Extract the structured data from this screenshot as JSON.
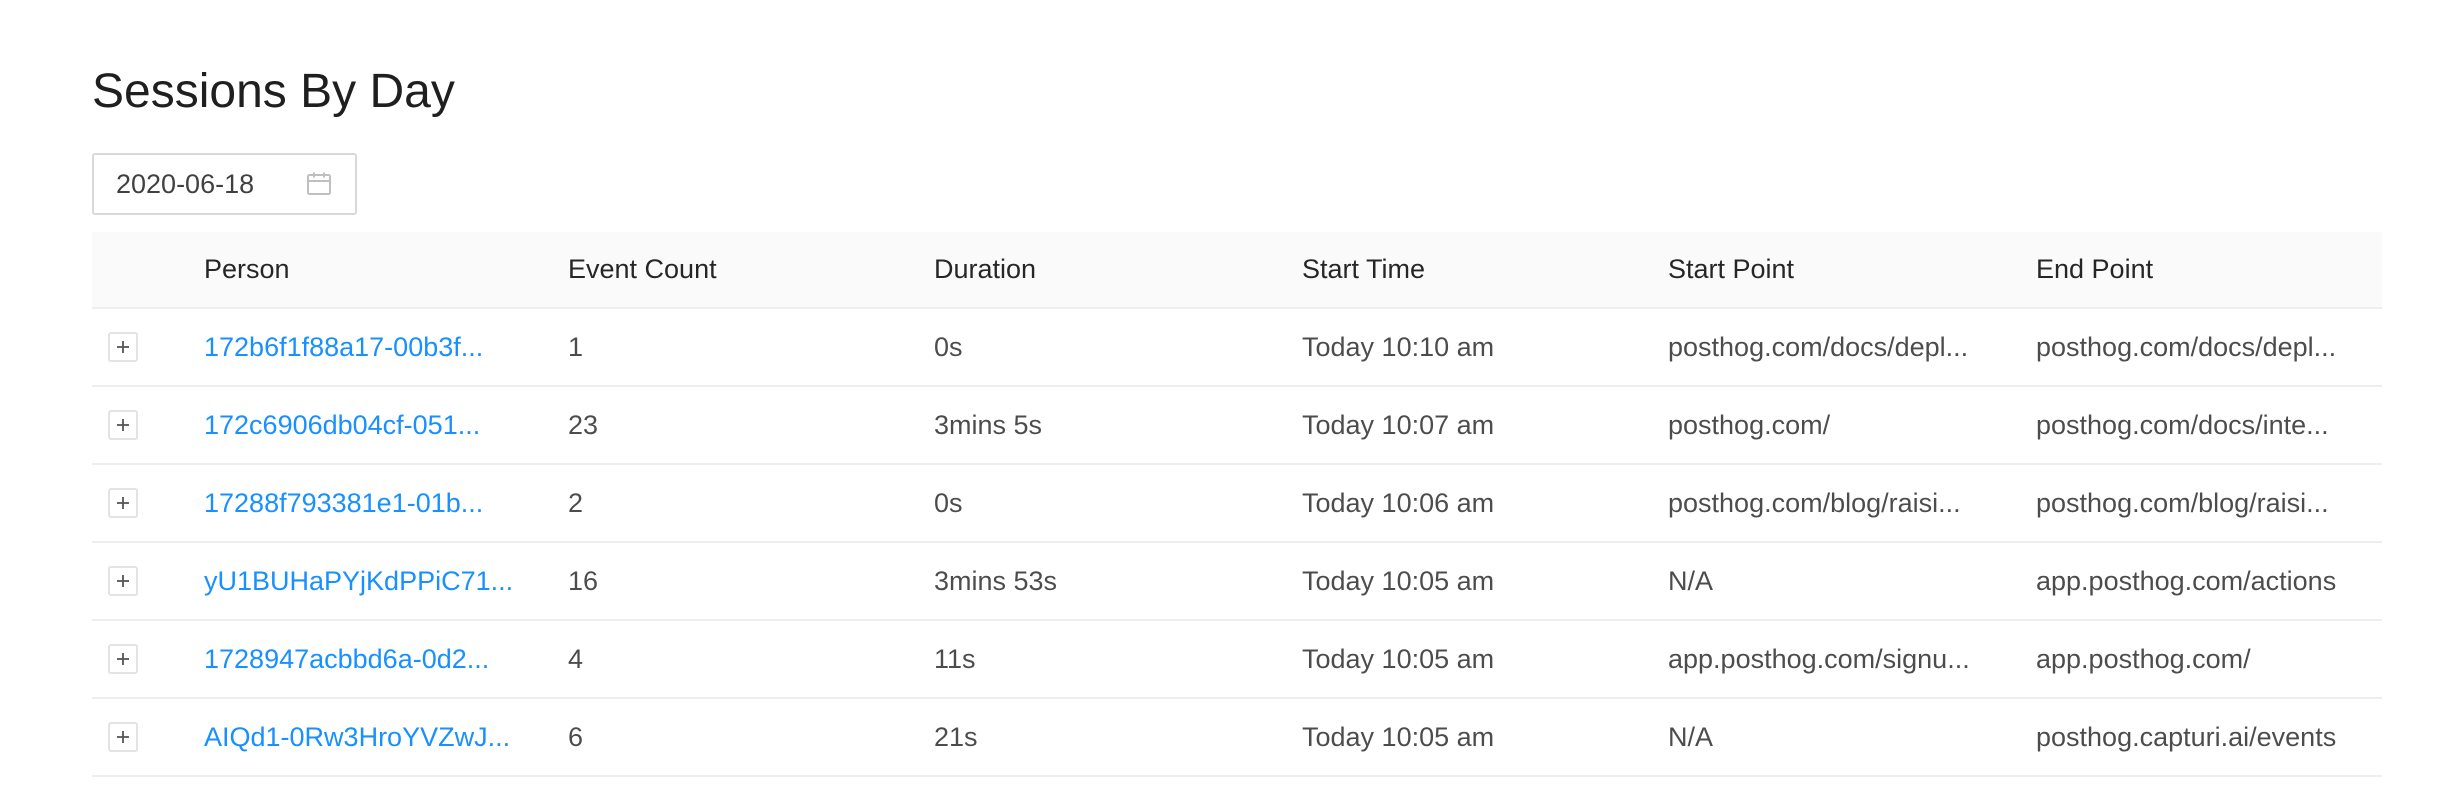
{
  "page": {
    "title": "Sessions By Day"
  },
  "date_picker": {
    "value": "2020-06-18",
    "icon": "calendar-icon"
  },
  "table": {
    "columns": [
      "",
      "Person",
      "Event Count",
      "Duration",
      "Start Time",
      "Start Point",
      "End Point"
    ],
    "rows": [
      {
        "person": "172b6f1f88a17-00b3f...",
        "event_count": "1",
        "duration": "0s",
        "start_time": "Today 10:10 am",
        "start_point": "posthog.com/docs/depl...",
        "end_point": "posthog.com/docs/depl..."
      },
      {
        "person": "172c6906db04cf-051...",
        "event_count": "23",
        "duration": "3mins 5s",
        "start_time": "Today 10:07 am",
        "start_point": "posthog.com/",
        "end_point": "posthog.com/docs/inte..."
      },
      {
        "person": "17288f793381e1-01b...",
        "event_count": "2",
        "duration": "0s",
        "start_time": "Today 10:06 am",
        "start_point": "posthog.com/blog/raisi...",
        "end_point": "posthog.com/blog/raisi..."
      },
      {
        "person": "yU1BUHaPYjKdPPiC71...",
        "event_count": "16",
        "duration": "3mins 53s",
        "start_time": "Today 10:05 am",
        "start_point": "N/A",
        "end_point": "app.posthog.com/actions"
      },
      {
        "person": "1728947acbbd6a-0d2...",
        "event_count": "4",
        "duration": "11s",
        "start_time": "Today 10:05 am",
        "start_point": "app.posthog.com/signu...",
        "end_point": "app.posthog.com/"
      },
      {
        "person": "AIQd1-0Rw3HroYVZwJ...",
        "event_count": "6",
        "duration": "21s",
        "start_time": "Today 10:05 am",
        "start_point": "N/A",
        "end_point": "posthog.capturi.ai/events"
      }
    ],
    "expand_icon": "plus-icon"
  },
  "colors": {
    "link": "#1890ff",
    "header_bg": "#fafafa",
    "border": "#eeeeee"
  }
}
